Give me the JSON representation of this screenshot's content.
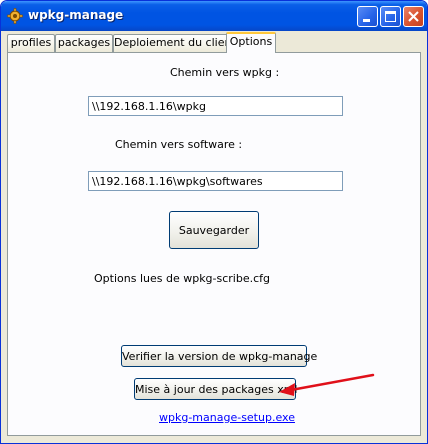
{
  "window": {
    "title": "wpkg-manage"
  },
  "tabs": [
    {
      "label": "profiles"
    },
    {
      "label": "packages"
    },
    {
      "label": "Deploiement du client"
    },
    {
      "label": "Options"
    }
  ],
  "options": {
    "wpkg_path_label": "Chemin vers wpkg :",
    "wpkg_path_value": "\\\\192.168.1.16\\wpkg",
    "software_path_label": "Chemin vers software :",
    "software_path_value": "\\\\192.168.1.16\\wpkg\\softwares",
    "save_button": "Sauvegarder",
    "status_text": "Options lues de wpkg-scribe.cfg",
    "verify_button": "Verifier la version de  wpkg-manage",
    "update_button": "Mise à jour des packages xml",
    "setup_link": "wpkg-manage-setup.exe"
  },
  "colors": {
    "titlebar": "#0054e3",
    "window_bg": "#ece9d8",
    "panel_bg": "#fcfcfe",
    "arrow": "#e0101a",
    "link": "#0000ff"
  }
}
